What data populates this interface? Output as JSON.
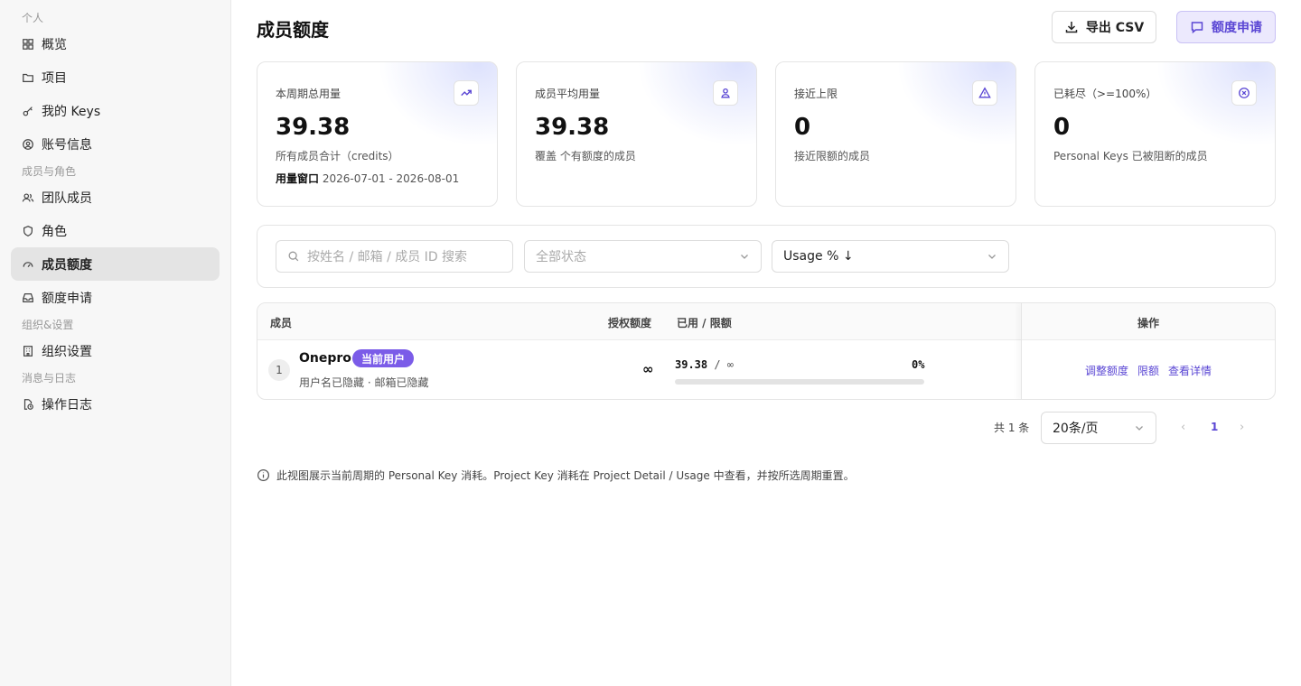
{
  "sidebar": {
    "sections": [
      {
        "label": "个人",
        "items": [
          {
            "label": "概览",
            "icon": "grid-icon"
          },
          {
            "label": "项目",
            "icon": "folder-icon"
          },
          {
            "label": "我的 Keys",
            "icon": "key-icon"
          },
          {
            "label": "账号信息",
            "icon": "user-circle-icon"
          }
        ]
      },
      {
        "label": "成员与角色",
        "items": [
          {
            "label": "团队成员",
            "icon": "users-icon"
          },
          {
            "label": "角色",
            "icon": "shield-icon"
          },
          {
            "label": "成员额度",
            "icon": "gauge-icon",
            "active": true
          },
          {
            "label": "额度申请",
            "icon": "inbox-icon"
          }
        ]
      },
      {
        "label": "组织&设置",
        "items": [
          {
            "label": "组织设置",
            "icon": "building-icon"
          }
        ]
      },
      {
        "label": "消息与日志",
        "items": [
          {
            "label": "操作日志",
            "icon": "file-clock-icon"
          }
        ]
      }
    ]
  },
  "header": {
    "title": "成员额度",
    "export_label": "导出 CSV",
    "request_label": "额度申请"
  },
  "stats": [
    {
      "title": "本周期总用量",
      "value": "39.38",
      "sub": "所有成员合计（credits）",
      "window_label": "用量窗口",
      "window_value": "2026-07-01 - 2026-08-01",
      "icon": "trending-up-icon"
    },
    {
      "title": "成员平均用量",
      "value": "39.38",
      "sub": "覆盖 个有额度的成员",
      "icon": "user-icon"
    },
    {
      "title": "接近上限",
      "value": "0",
      "sub": "接近限额的成员",
      "icon": "warning-icon"
    },
    {
      "title": "已耗尽（>=100%）",
      "value": "0",
      "sub": "Personal Keys 已被阻断的成员",
      "icon": "x-circle-icon"
    }
  ],
  "filters": {
    "search_placeholder": "按姓名 / 邮箱 / 成员 ID 搜索",
    "status_value": "全部状态",
    "sort_value": "Usage % ↓"
  },
  "table": {
    "columns": {
      "member": "成员",
      "quota": "授权额度",
      "used": "已用 / 限额",
      "ops": "操作"
    },
    "rows": [
      {
        "index": "1",
        "name": "Onepro",
        "badge": "当前用户",
        "sub": "用户名已隐藏 · 邮箱已隐藏",
        "quota": "∞",
        "used": "39.38",
        "limit": "/ ∞",
        "percent_label": "0%",
        "progress": 0,
        "actions": [
          "调整额度",
          "限额",
          "查看详情"
        ]
      }
    ]
  },
  "pagination": {
    "total": "共 1 条",
    "page_size": "20条/页",
    "current": "1",
    "prev": "‹",
    "next": "›"
  },
  "note": "此视图展示当前周期的 Personal Key 消耗。Project Key 消耗在 Project Detail / Usage 中查看，并按所选周期重置。",
  "colors": {
    "accent": "#5a46d4",
    "badge": "#7b5ce8",
    "active_nav": "#e4e4e4"
  }
}
